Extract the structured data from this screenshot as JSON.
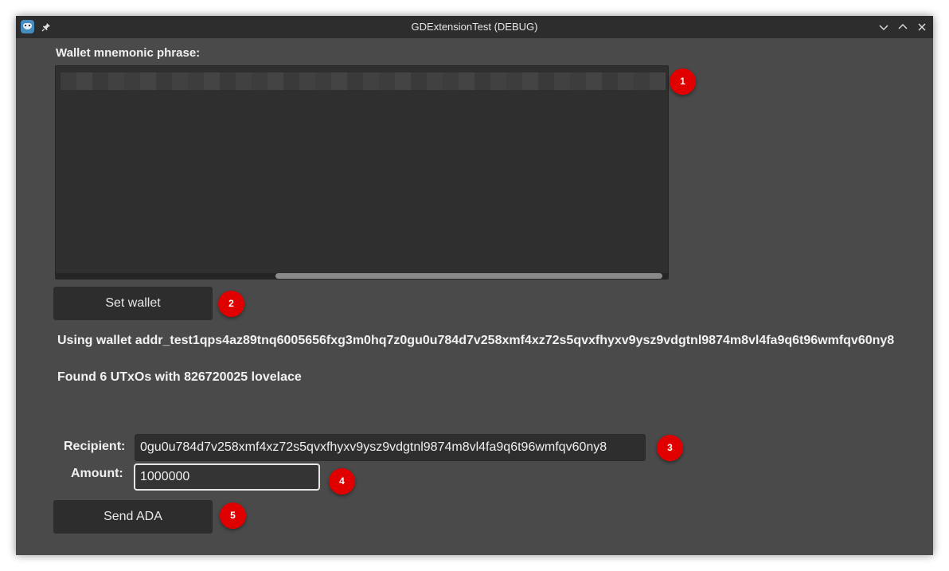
{
  "window": {
    "title": "GDExtensionTest (DEBUG)",
    "icons": {
      "app": "godot-icon",
      "pin": "pin-icon"
    },
    "controls": {
      "minimize": "chevron-down-icon",
      "maximize": "chevron-up-icon",
      "close": "close-icon"
    }
  },
  "wallet": {
    "mnemonic_label": "Wallet mnemonic phrase:",
    "set_wallet_label": "Set wallet",
    "using_wallet_text": "Using wallet addr_test1qps4az89tnq6005656fxg3m0hq7z0gu0u784d7v258xmf4xz72s5qvxfhyxv9ysz9vdgtnl9874m8vl4fa9q6t96wmfqv60ny8",
    "utxo_text": "Found 6 UTxOs with 826720025 lovelace"
  },
  "send": {
    "recipient_label": "Recipient:",
    "recipient_value": "0gu0u784d7v258xmf4xz72s5qvxfhyxv9ysz9vdgtnl9874m8vl4fa9q6t96wmfqv60ny8",
    "amount_label": "Amount:",
    "amount_value": "1000000",
    "send_label": "Send ADA"
  },
  "badges": [
    "1",
    "2",
    "3",
    "4",
    "5"
  ],
  "colors": {
    "window_bg": "#4a4a4a",
    "titlebar_bg": "#2d2d2d",
    "badge": "#e00000"
  }
}
